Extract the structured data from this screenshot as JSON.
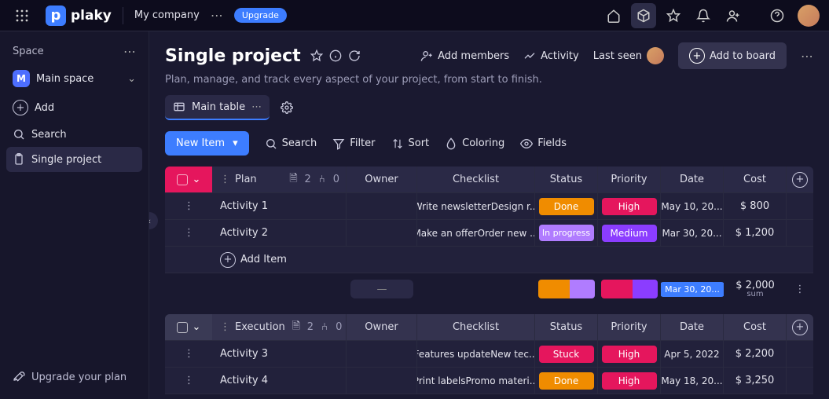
{
  "topbar": {
    "brand": "plaky",
    "company": "My company",
    "upgrade": "Upgrade"
  },
  "sidebar": {
    "space_label": "Space",
    "main_space": "Main space",
    "add": "Add",
    "search": "Search",
    "project": "Single project",
    "upgrade_plan": "Upgrade your plan"
  },
  "header": {
    "title": "Single project",
    "subtitle": "Plan, manage, and track every aspect of your project, from start to finish.",
    "add_members": "Add members",
    "activity": "Activity",
    "last_seen": "Last seen",
    "add_to_board": "Add to board"
  },
  "view": {
    "main_table": "Main table"
  },
  "toolbar": {
    "new_item": "New Item",
    "search": "Search",
    "filter": "Filter",
    "sort": "Sort",
    "coloring": "Coloring",
    "fields": "Fields"
  },
  "cols": {
    "plan": "Plan",
    "owner": "Owner",
    "checklist": "Checklist",
    "status": "Status",
    "priority": "Priority",
    "date": "Date",
    "cost": "Cost",
    "execution": "Execution",
    "file_count": "2",
    "sub_count": "0"
  },
  "add_item": "Add Item",
  "groups": [
    {
      "name": "Plan",
      "color": "#e5165d",
      "rows": [
        {
          "name": "Activity 1",
          "checklist": "Write newsletterDesign r...",
          "status": "Done",
          "status_class": "status-done",
          "priority": "High",
          "priority_class": "prio-high",
          "date": "May 10, 20...",
          "cost": "$ 800"
        },
        {
          "name": "Activity 2",
          "checklist": "Make an offerOrder new ...",
          "status": "In progress",
          "status_class": "status-progress",
          "priority": "Medium",
          "priority_class": "prio-med",
          "date": "Mar 30, 20...",
          "cost": "$ 1,200"
        }
      ],
      "summary": {
        "status_bar": [
          [
            "#f08c00",
            "55%"
          ],
          [
            "#b07cff",
            "45%"
          ]
        ],
        "prio_bar": [
          [
            "#e5165d",
            "55%"
          ],
          [
            "#8b3dff",
            "45%"
          ]
        ],
        "date": "Mar 30, 20...",
        "cost": "$ 2,000",
        "cost_label": "sum"
      }
    },
    {
      "name": "Execution",
      "color": "#58586f",
      "rows": [
        {
          "name": "Activity 3",
          "checklist": "Features updateNew tec...",
          "status": "Stuck",
          "status_class": "status-stuck",
          "priority": "High",
          "priority_class": "prio-high",
          "date": "Apr 5, 2022",
          "cost": "$ 2,200"
        },
        {
          "name": "Activity 4",
          "checklist": "Print labelsPromo materi...",
          "status": "Done",
          "status_class": "status-done",
          "priority": "High",
          "priority_class": "prio-high",
          "date": "May 18, 20...",
          "cost": "$ 3,250"
        }
      ]
    }
  ]
}
